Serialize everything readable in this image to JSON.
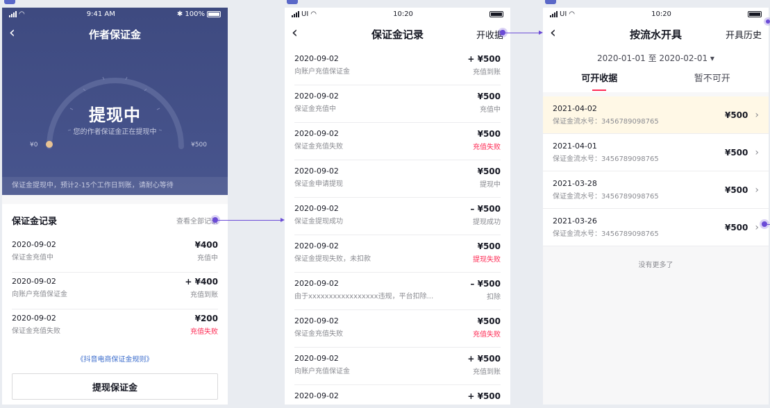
{
  "phone1": {
    "status": {
      "time": "9:41 AM",
      "battery": "✱ 100%"
    },
    "title": "作者保证金",
    "gauge": {
      "title": "提现中",
      "subtitle": "您的作者保证金正在提现中",
      "min": "¥0",
      "max": "¥500"
    },
    "notice": "保证金提现中，预计2-15个工作日到账，请耐心等待",
    "records_title": "保证金记录",
    "view_all": "查看全部记录",
    "records": [
      {
        "date": "2020-09-02",
        "desc": "保证金充值中",
        "amount": "¥400",
        "status": "充值中"
      },
      {
        "date": "2020-09-02",
        "desc": "向账户充值保证金",
        "amount": "+ ¥400",
        "status": "充值到账"
      },
      {
        "date": "2020-09-02",
        "desc": "保证金充值失败",
        "amount": "¥200",
        "status": "充值失败"
      }
    ],
    "rules_link": "《抖音电商保证金规则》",
    "button": "提现保证金"
  },
  "phone2": {
    "status": {
      "carrier": "UI",
      "time": "10:20"
    },
    "title": "保证金记录",
    "right_action": "开收据",
    "records": [
      {
        "date": "2020-09-02",
        "desc": "向账户充值保证金",
        "amount": "+ ¥500",
        "status": "充值到账"
      },
      {
        "date": "2020-09-02",
        "desc": "保证金充值中",
        "amount": "¥500",
        "status": "充值中"
      },
      {
        "date": "2020-09-02",
        "desc": "保证金充值失败",
        "amount": "¥500",
        "status": "充值失败"
      },
      {
        "date": "2020-09-02",
        "desc": "保证金申请提现",
        "amount": "¥500",
        "status": "提现中"
      },
      {
        "date": "2020-09-02",
        "desc": "保证金提现成功",
        "amount": "– ¥500",
        "status": "提现成功"
      },
      {
        "date": "2020-09-02",
        "desc": "保证金提现失败，未扣款",
        "amount": "¥500",
        "status": "提现失败"
      },
      {
        "date": "2020-09-02",
        "desc": "由于xxxxxxxxxxxxxxxxx违规，平台扣除...",
        "amount": "– ¥500",
        "status": "扣除"
      },
      {
        "date": "2020-09-02",
        "desc": "保证金充值失败",
        "amount": "¥500",
        "status": "充值失败"
      },
      {
        "date": "2020-09-02",
        "desc": "向账户充值保证金",
        "amount": "+ ¥500",
        "status": "充值到账"
      },
      {
        "date": "2020-09-02",
        "desc": "",
        "amount": "+ ¥500",
        "status": ""
      }
    ]
  },
  "phone3": {
    "status": {
      "carrier": "UI",
      "time": "10:20"
    },
    "title": "按流水开具",
    "right_action": "开具历史",
    "date_range": "2020-01-01 至 2020-02-01 ▾",
    "tabs": [
      "可开收据",
      "暂不可开"
    ],
    "rows": [
      {
        "date": "2021-04-02",
        "serial": "保证金流水号：3456789098765",
        "amount": "¥500"
      },
      {
        "date": "2021-04-01",
        "serial": "保证金流水号：3456789098765",
        "amount": "¥500"
      },
      {
        "date": "2021-03-28",
        "serial": "保证金流水号：3456789098765",
        "amount": "¥500"
      },
      {
        "date": "2021-03-26",
        "serial": "保证金流水号：3456789098765",
        "amount": "¥500"
      }
    ],
    "no_more": "没有更多了"
  },
  "colors": {
    "accent": "#fe2c55",
    "link": "#3d6ecd",
    "connector": "#6b4bd6",
    "hero": "#3e4a80",
    "highlight": "#fff8e6"
  }
}
